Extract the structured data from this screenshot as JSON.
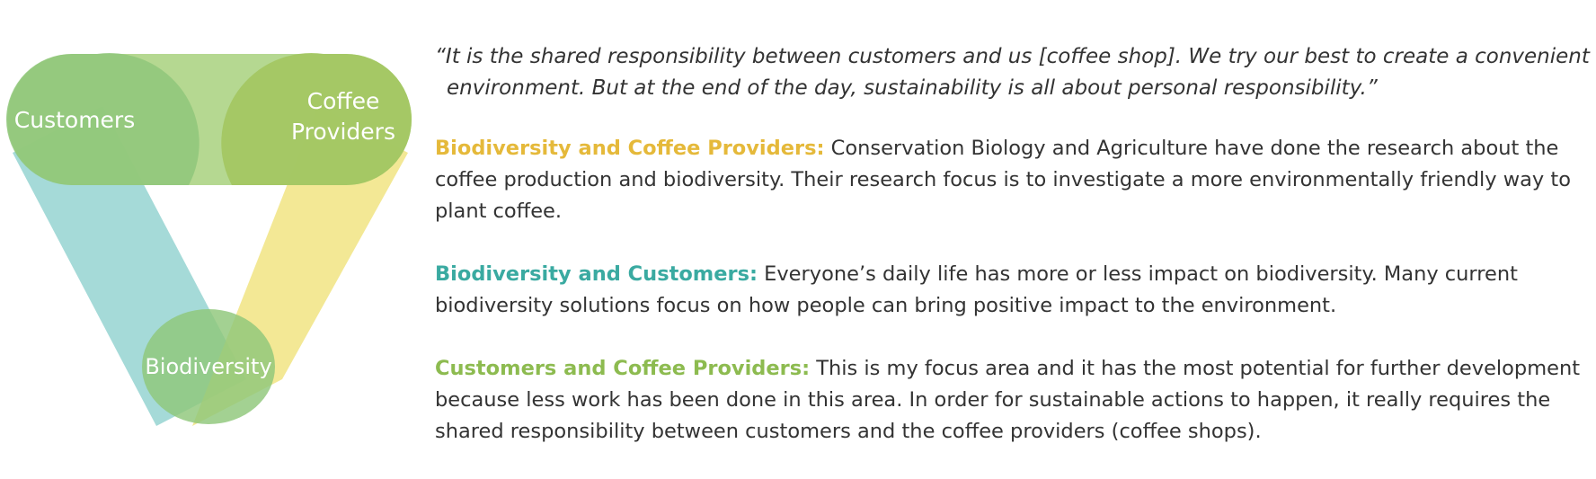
{
  "colors": {
    "customers": "#8fc77a",
    "coffee_providers": "#a3c760",
    "biodiversity": "#8fc77a",
    "blue_band": "#8ccfcd",
    "yellow_band": "#efe177",
    "green_band": "#a8d17e",
    "text": "#333333",
    "heading_yellow": "#e5b93a",
    "heading_teal": "#3aaaa1",
    "heading_green": "#8dbb50"
  },
  "diagram": {
    "nodes": [
      {
        "id": "customers",
        "label_lines": [
          "Customers"
        ]
      },
      {
        "id": "coffee_providers",
        "label_lines": [
          "Coffee",
          "Providers"
        ]
      },
      {
        "id": "biodiversity",
        "label_lines": [
          "Biodiversity"
        ]
      }
    ]
  },
  "quote": "“It is the shared responsibility between customers and us [coffee shop]. We try our best to create a convenient environment. But at the end of the day, sustainability is all about personal responsibility.”",
  "quote_lines": [
    "“It is the shared responsibility between customers and us [coffee shop]. We try our best to create a convenient",
    "environment. But at the end of the day, sustainability is all about personal responsibility.”"
  ],
  "sections": [
    {
      "heading": "Biodiversity and Coffee Providers:",
      "body": " Conservation Biology and Agriculture have done the research about the coffee production and biodiversity. Their research focus is to investigate a more environmentally friendly way to plant coffee."
    },
    {
      "heading": "Biodiversity and Customers:",
      "body": " Everyone’s daily life has more or less impact on biodiversity. Many current biodiversity solutions focus on how people can bring positive impact to the environment."
    },
    {
      "heading": "Customers and Coffee Providers:",
      "body": " This is my focus area and it has the most potential for further development because less work has been done in this area. In order for sustainable actions to happen, it really requires the shared responsibility between customers and the coffee providers (coffee shops)."
    }
  ]
}
